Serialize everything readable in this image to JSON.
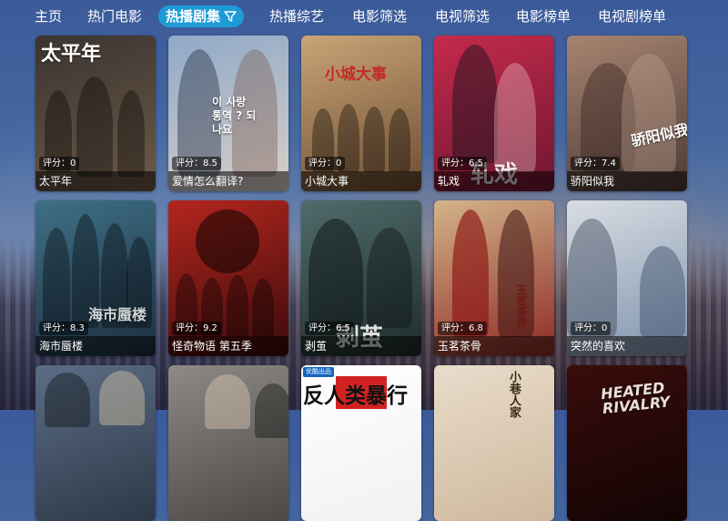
{
  "nav": {
    "items": [
      "主页",
      "热门电影",
      "热播剧集",
      "热播综艺",
      "电影筛选",
      "电视筛选",
      "电影榜单",
      "电视剧榜单"
    ],
    "active_index": 2,
    "active_icon": "filter-icon",
    "accent": "#1e9bd7"
  },
  "cards": [
    {
      "title": "太平年",
      "rating": "评分：0",
      "poster_text": "太平年",
      "colors": [
        "#3a3430",
        "#6d5a48"
      ]
    },
    {
      "title": "爱情怎么翻译?",
      "rating": "评分：8.5",
      "poster_text": "이 사랑 통역 ? 되나요",
      "colors": [
        "#8fa9c8",
        "#d9cfc8"
      ]
    },
    {
      "title": "小城大事",
      "rating": "评分：0",
      "poster_text": "小城大事",
      "colors": [
        "#c9a477",
        "#6e4e32"
      ]
    },
    {
      "title": "轧戏",
      "rating": "评分：6.5",
      "poster_text": "轧戏",
      "colors": [
        "#c52a4d",
        "#6e1630"
      ]
    },
    {
      "title": "骄阳似我",
      "rating": "评分：7.4",
      "poster_text": "骄阳似我",
      "colors": [
        "#a88470",
        "#4a3a36"
      ]
    },
    {
      "title": "海市蜃楼",
      "rating": "评分：8.3",
      "poster_text": "海市蜃楼",
      "colors": [
        "#3f6f86",
        "#1c2f3f"
      ]
    },
    {
      "title": "怪奇物语 第五季",
      "rating": "评分：9.2",
      "poster_text": "",
      "colors": [
        "#b3261e",
        "#3b0b0b"
      ]
    },
    {
      "title": "剥茧",
      "rating": "评分：6.5",
      "poster_text": "剥茧",
      "colors": [
        "#4f6b6a",
        "#1f2c2c"
      ]
    },
    {
      "title": "玉茗茶骨",
      "rating": "评分：6.8",
      "poster_text": "玉茗茶骨",
      "colors": [
        "#d3b48a",
        "#8e2a24"
      ]
    },
    {
      "title": "突然的喜欢",
      "rating": "评分：0",
      "poster_text": "",
      "colors": [
        "#d9dde3",
        "#7f93ad"
      ]
    },
    {
      "title": "",
      "rating": "",
      "poster_text": "",
      "colors": [
        "#5b6d86",
        "#2d3847"
      ]
    },
    {
      "title": "",
      "rating": "",
      "poster_text": "",
      "colors": [
        "#8d8a86",
        "#4b4845"
      ]
    },
    {
      "title": "",
      "rating": "",
      "poster_text": "反人类暴行",
      "badge": "优酷出品",
      "colors": [
        "#ffffff",
        "#f1f1f1"
      ]
    },
    {
      "title": "",
      "rating": "",
      "poster_text": "小巷人家",
      "colors": [
        "#e9dccb",
        "#cdb89c"
      ]
    },
    {
      "title": "",
      "rating": "",
      "poster_text": "HEATED RIVALRY",
      "colors": [
        "#3a0c0c",
        "#120404"
      ]
    }
  ]
}
